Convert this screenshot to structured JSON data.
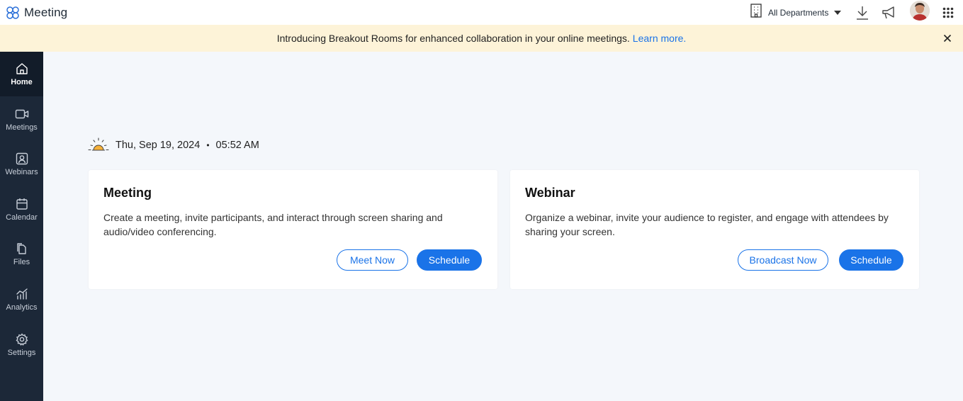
{
  "app": {
    "title": "Meeting"
  },
  "header": {
    "department_label": "All Departments",
    "icons": [
      "building-icon",
      "download-icon",
      "megaphone-icon",
      "avatar",
      "apps-grid-icon"
    ]
  },
  "banner": {
    "text": "Introducing Breakout Rooms for enhanced collaboration in your online meetings.",
    "link": "Learn more."
  },
  "sidebar": {
    "items": [
      {
        "label": "Home",
        "icon": "home-icon",
        "active": true
      },
      {
        "label": "Meetings",
        "icon": "video-camera-icon"
      },
      {
        "label": "Webinars",
        "icon": "webinar-icon"
      },
      {
        "label": "Calendar",
        "icon": "calendar-icon"
      },
      {
        "label": "Files",
        "icon": "files-icon"
      },
      {
        "label": "Analytics",
        "icon": "analytics-icon"
      },
      {
        "label": "Settings",
        "icon": "gear-icon"
      }
    ]
  },
  "greeting": {
    "date": "Thu, Sep 19, 2024",
    "separator": "•",
    "time": "05:52 AM"
  },
  "cards": [
    {
      "title": "Meeting",
      "desc_line1": "Create a meeting, invite participants, and interact through screen sharing and",
      "desc_line2": "audio/video conferencing.",
      "secondary_button": "Meet Now",
      "primary_button": "Schedule"
    },
    {
      "title": "Webinar",
      "desc_line1": "Organize a webinar, invite your audience to register, and engage with attendees by",
      "desc_line2": "sharing your screen.",
      "secondary_button": "Broadcast Now",
      "primary_button": "Schedule"
    }
  ],
  "colors": {
    "accent": "#1a73e8",
    "sidebar_bg": "#1c2838",
    "sidebar_active_bg": "#121c29",
    "banner_bg": "#fdf3d8",
    "page_bg": "#f4f7fb"
  }
}
